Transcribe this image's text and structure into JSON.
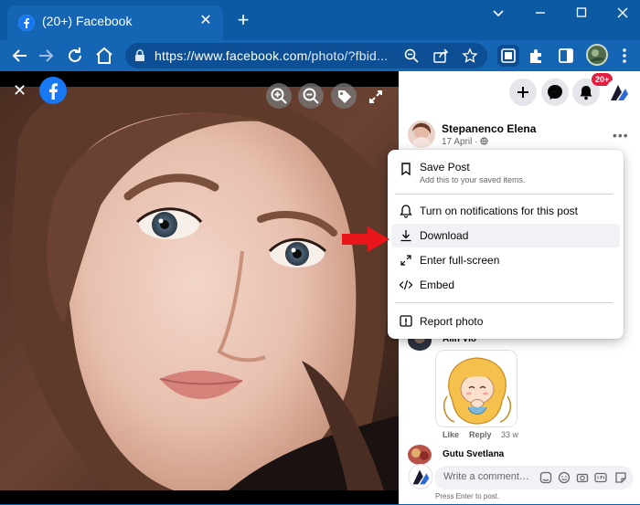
{
  "browser": {
    "tab_title": "(20+) Facebook",
    "tab_close": "✕",
    "new_tab": "+",
    "url_host": "https://www.facebook.com",
    "url_path": "/photo/?fbid..."
  },
  "viewer": {
    "close_glyph": "✕"
  },
  "header": {
    "notifications_badge": "20+"
  },
  "post": {
    "author": "Stepanenco Elena",
    "date": "17 April ·",
    "more": "•••"
  },
  "menu": {
    "items": [
      {
        "label": "Save Post",
        "sub": "Add this to your saved items.",
        "icon": "bookmark-icon"
      },
      {
        "label": "Turn on notifications for this post",
        "icon": "bell-icon"
      },
      {
        "label": "Download",
        "icon": "download-icon",
        "highlighted": true
      },
      {
        "label": "Enter full-screen",
        "icon": "expand-icon"
      },
      {
        "label": "Embed",
        "icon": "code-icon"
      },
      {
        "label": "Report photo",
        "icon": "report-icon"
      }
    ]
  },
  "comments": [
    {
      "author": "Alin Vio",
      "like": "Like",
      "reply": "Reply",
      "time": "33 w"
    },
    {
      "author": "Gutu Svetlana"
    }
  ],
  "composer": {
    "placeholder": "Write a comment…",
    "hint": "Press Enter to post."
  },
  "colors": {
    "chrome_blue": "#0b5aa3",
    "facebook_blue": "#1877f2",
    "badge_red": "#e41e3f",
    "arrow_red": "#e8161b"
  }
}
